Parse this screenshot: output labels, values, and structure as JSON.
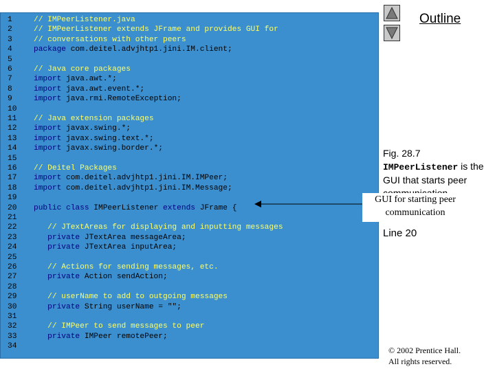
{
  "code_lines": [
    {
      "n": "1",
      "parts": [
        {
          "t": "// IMPeerListener.java",
          "c": "comment"
        }
      ]
    },
    {
      "n": "2",
      "parts": [
        {
          "t": "// IMPeerListener extends JFrame and provides GUI for",
          "c": "comment"
        }
      ]
    },
    {
      "n": "3",
      "parts": [
        {
          "t": "// conversations with other peers",
          "c": "comment"
        }
      ]
    },
    {
      "n": "4",
      "parts": [
        {
          "t": "package",
          "c": "kw"
        },
        {
          "t": " com.deitel.advjhtp1.jini.IM.client;",
          "c": "code"
        }
      ]
    },
    {
      "n": "5",
      "parts": []
    },
    {
      "n": "6",
      "parts": [
        {
          "t": "// Java core packages",
          "c": "comment"
        }
      ]
    },
    {
      "n": "7",
      "parts": [
        {
          "t": "import",
          "c": "kw"
        },
        {
          "t": " java.awt.*;",
          "c": "code"
        }
      ]
    },
    {
      "n": "8",
      "parts": [
        {
          "t": "import",
          "c": "kw"
        },
        {
          "t": " java.awt.event.*;",
          "c": "code"
        }
      ]
    },
    {
      "n": "9",
      "parts": [
        {
          "t": "import",
          "c": "kw"
        },
        {
          "t": " java.rmi.RemoteException;",
          "c": "code"
        }
      ]
    },
    {
      "n": "10",
      "parts": []
    },
    {
      "n": "11",
      "parts": [
        {
          "t": "// Java extension packages",
          "c": "comment"
        }
      ]
    },
    {
      "n": "12",
      "parts": [
        {
          "t": "import",
          "c": "kw"
        },
        {
          "t": " javax.swing.*;",
          "c": "code"
        }
      ]
    },
    {
      "n": "13",
      "parts": [
        {
          "t": "import",
          "c": "kw"
        },
        {
          "t": " javax.swing.text.*;",
          "c": "code"
        }
      ]
    },
    {
      "n": "14",
      "parts": [
        {
          "t": "import",
          "c": "kw"
        },
        {
          "t": " javax.swing.border.*;",
          "c": "code"
        }
      ]
    },
    {
      "n": "15",
      "parts": []
    },
    {
      "n": "16",
      "parts": [
        {
          "t": "// Deitel Packages",
          "c": "comment"
        }
      ]
    },
    {
      "n": "17",
      "parts": [
        {
          "t": "import",
          "c": "kw"
        },
        {
          "t": " com.deitel.advjhtp1.jini.IM.IMPeer;",
          "c": "code"
        }
      ]
    },
    {
      "n": "18",
      "parts": [
        {
          "t": "import",
          "c": "kw"
        },
        {
          "t": " com.deitel.advjhtp1.jini.IM.Message;",
          "c": "code"
        }
      ]
    },
    {
      "n": "19",
      "parts": []
    },
    {
      "n": "20",
      "parts": [
        {
          "t": "public class",
          "c": "kw"
        },
        {
          "t": " IMPeerListener ",
          "c": "code"
        },
        {
          "t": "extends",
          "c": "kw"
        },
        {
          "t": " JFrame {",
          "c": "code"
        }
      ]
    },
    {
      "n": "21",
      "parts": []
    },
    {
      "n": "22",
      "parts": [
        {
          "t": "   // JTextAreas for displaying and inputting messages",
          "c": "comment"
        }
      ]
    },
    {
      "n": "23",
      "parts": [
        {
          "t": "   private",
          "c": "kw"
        },
        {
          "t": " JTextArea messageArea;",
          "c": "code"
        }
      ]
    },
    {
      "n": "24",
      "parts": [
        {
          "t": "   private",
          "c": "kw"
        },
        {
          "t": " JTextArea inputArea;",
          "c": "code"
        }
      ]
    },
    {
      "n": "25",
      "parts": []
    },
    {
      "n": "26",
      "parts": [
        {
          "t": "   // Actions for sending messages, etc.",
          "c": "comment"
        }
      ]
    },
    {
      "n": "27",
      "parts": [
        {
          "t": "   private",
          "c": "kw"
        },
        {
          "t": " Action sendAction;",
          "c": "code"
        }
      ]
    },
    {
      "n": "28",
      "parts": []
    },
    {
      "n": "29",
      "parts": [
        {
          "t": "   // userName to add to outgoing messages",
          "c": "comment"
        }
      ]
    },
    {
      "n": "30",
      "parts": [
        {
          "t": "   private",
          "c": "kw"
        },
        {
          "t": " String userName = \"\";",
          "c": "code"
        }
      ]
    },
    {
      "n": "31",
      "parts": []
    },
    {
      "n": "32",
      "parts": [
        {
          "t": "   // IMPeer to send messages to peer",
          "c": "comment"
        }
      ]
    },
    {
      "n": "33",
      "parts": [
        {
          "t": "   private",
          "c": "kw"
        },
        {
          "t": " IMPeer remotePeer;",
          "c": "code"
        }
      ]
    },
    {
      "n": "34",
      "parts": []
    }
  ],
  "sidebar": {
    "outline_label": "Outline",
    "up_icon": "triangle-up-icon",
    "down_icon": "triangle-down-icon",
    "fig_number": "Fig. 28.7",
    "fig_class": "IMPeerListener",
    "fig_rest": " is the GUI that starts peer communication",
    "callout_text": "GUI for starting peer communication",
    "line_ref": "Line 20",
    "copyright_line1": "© 2002 Prentice Hall.",
    "copyright_line2": "All rights reserved."
  },
  "colors": {
    "panel_bg": "#3c8fcf",
    "comment": "#ffff66",
    "keyword": "#000080",
    "code": "#000000"
  }
}
